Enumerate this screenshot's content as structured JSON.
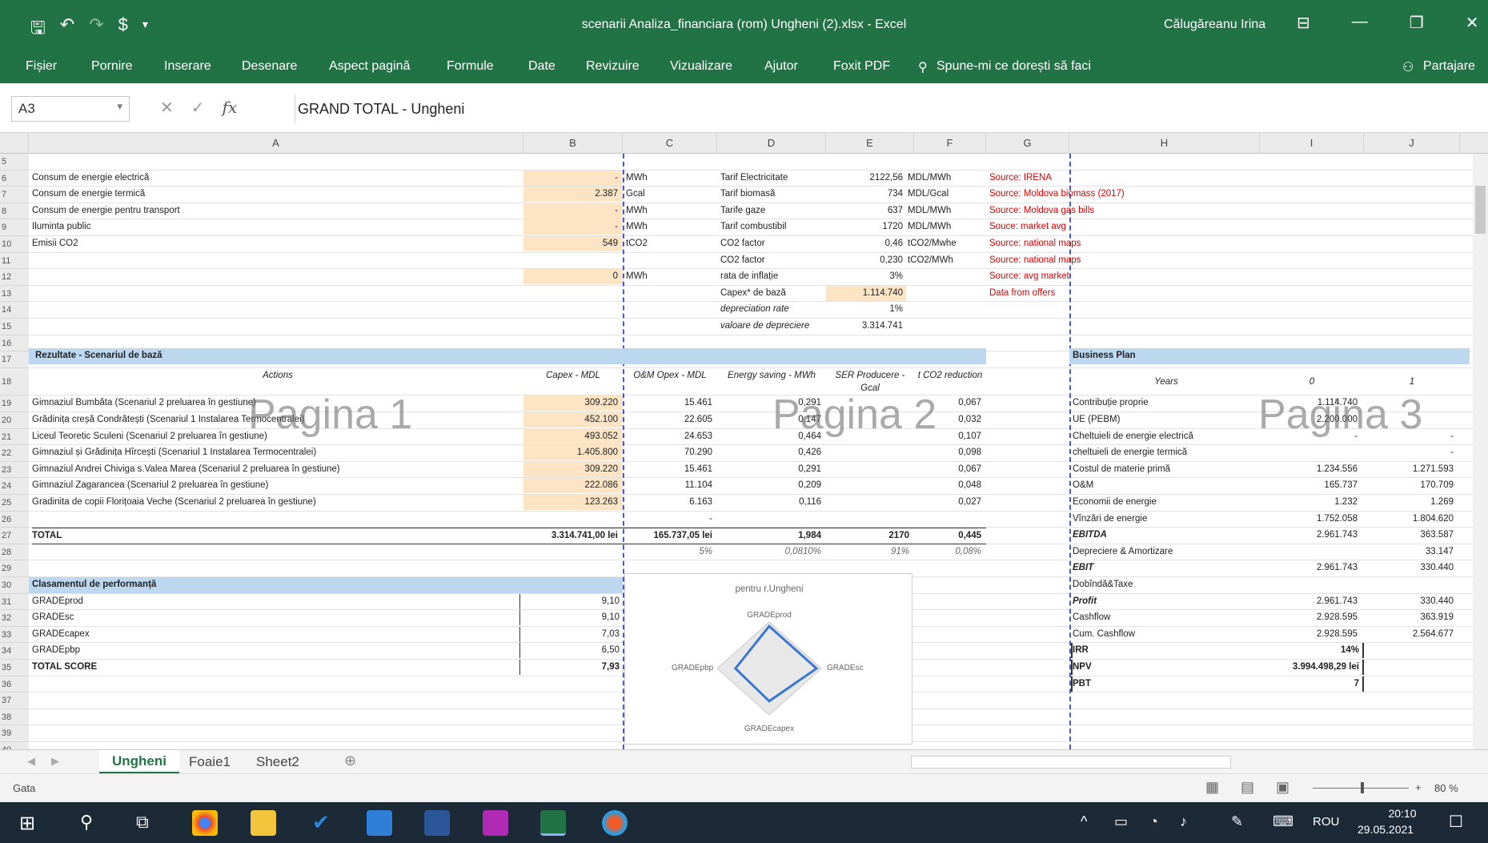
{
  "window": {
    "title": "scenarii Analiza_financiara (rom) Ungheni (2).xlsx  -  Excel",
    "user": "Călugăreanu Irina"
  },
  "ribbon": {
    "tabs": [
      "Fișier",
      "Pornire",
      "Inserare",
      "Desenare",
      "Aspect pagină",
      "Formule",
      "Date",
      "Revizuire",
      "Vizualizare",
      "Ajutor",
      "Foxit PDF"
    ],
    "tell_me": "Spune-mi ce dorești să faci",
    "share": "Partajare"
  },
  "formula_bar": {
    "name_box": "A3",
    "content": "GRAND TOTAL - Ungheni"
  },
  "columns": [
    "A",
    "B",
    "C",
    "D",
    "E",
    "F",
    "G",
    "H",
    "I",
    "J"
  ],
  "rows": [
    "5",
    "6",
    "7",
    "8",
    "9",
    "10",
    "11",
    "12",
    "13",
    "14",
    "15",
    "16",
    "17",
    "18",
    "19",
    "20",
    "21",
    "22",
    "23",
    "24",
    "25",
    "26",
    "27",
    "28",
    "29",
    "30",
    "31",
    "32",
    "33",
    "34",
    "35",
    "36",
    "37",
    "38",
    "39",
    "40"
  ],
  "inputs": [
    {
      "label": "Consum de energie electrică",
      "value": "-",
      "unit": "MWh"
    },
    {
      "label": "Consum de energie termică",
      "value": "2.387",
      "unit": "Gcal"
    },
    {
      "label": "Consum de energie pentru transport",
      "value": "-",
      "unit": "MWh"
    },
    {
      "label": "Iluminta public",
      "value": "-",
      "unit": "MWh"
    },
    {
      "label": "Emisii CO2",
      "value": "549",
      "unit": "tCO2"
    },
    {
      "label": "",
      "value": "",
      "unit": ""
    },
    {
      "label": "",
      "value": "0",
      "unit": "MWh"
    }
  ],
  "tariffs": [
    {
      "name": "Tarif Electricitate",
      "value": "2122,56",
      "unit": "MDL/MWh",
      "source": "Source: IRENA"
    },
    {
      "name": "Tarif biomasă",
      "value": "734",
      "unit": "MDL/Gcal",
      "source": "Source: Moldova biomass (2017)"
    },
    {
      "name": "Tarife gaze",
      "value": "637",
      "unit": "MDL/MWh",
      "source": "Source: Moldova gas bills"
    },
    {
      "name": "Tarif combustibil",
      "value": "1720",
      "unit": "MDL/MWh",
      "source": "Souce: market avg"
    },
    {
      "name": "CO2 factor",
      "value": "0,46",
      "unit": "tCO2/Mwhe",
      "source": "Source: national maps"
    },
    {
      "name": "CO2 factor",
      "value": "0,230",
      "unit": "tCO2/MWh",
      "source": "Source: national maps"
    },
    {
      "name": "rata de inflație",
      "value": "3%",
      "unit": "",
      "source": "Source: avg market"
    },
    {
      "name": "Capex* de bază",
      "value": "1.114.740",
      "unit": "",
      "source": "Data from offers"
    },
    {
      "name": "depreciation rate",
      "value": "1%",
      "unit": "",
      "source": ""
    },
    {
      "name": "valoare de depreciere",
      "value": "3.314.741",
      "unit": "",
      "source": ""
    }
  ],
  "results": {
    "title": "Rezultate - Scenariul de bază",
    "headers": [
      "Actions",
      "Capex - MDL",
      "O&M Opex - MDL",
      "Energy saving - MWh",
      "SER Producere - Gcal",
      "t CO2 reduction"
    ],
    "rows": [
      [
        "Gimnaziul Bumbăta (Scenariul 2 preluarea în gestiune)",
        "309.220",
        "15.461",
        "0,291",
        "",
        "0,067"
      ],
      [
        "Grădinița creșă Condrătești (Scenariul 1 Instalarea Termocentralei)",
        "452.100",
        "22.605",
        "0,147",
        "",
        "0,032"
      ],
      [
        "Liceul Teoretic Sculeni (Scenariul 2 preluarea în gestiune)",
        "493.052",
        "24.653",
        "0,464",
        "",
        "0,107"
      ],
      [
        "Gimnaziul și Grădinița Hîrcești (Scenariul 1 Instalarea Termocentralei)",
        "1.405.800",
        "70.290",
        "0,426",
        "",
        "0,098"
      ],
      [
        "Gimnaziul Andrei Chiviga s.Valea Marea (Scenariul 2 preluarea în gestiune)",
        "309.220",
        "15.461",
        "0,291",
        "",
        "0,067"
      ],
      [
        "Gimnaziul Zagarancea (Scenariul 2 preluarea în gestiune)",
        "222.086",
        "11.104",
        "0,209",
        "",
        "0,048"
      ],
      [
        "Gradinita de copii Florițoaia Veche (Scenariul 2 preluarea în gestiune)",
        "123.263",
        "6.163",
        "0,116",
        "",
        "0,027"
      ],
      [
        "",
        "",
        "-",
        "",
        "",
        ""
      ]
    ],
    "total": [
      "TOTAL",
      "3.314.741,00 lei",
      "165.737,05 lei",
      "1,984",
      "2170",
      "0,445"
    ],
    "pct": [
      "",
      "",
      "5%",
      "0,0810%",
      "91%",
      "0,08%"
    ]
  },
  "performance": {
    "title": "Clasamentul de performanță",
    "rows": [
      [
        "GRADEprod",
        "9,10"
      ],
      [
        "GRADEsc",
        "9,10"
      ],
      [
        "GRADEcapex",
        "7,03"
      ],
      [
        "GRADEpbp",
        "6,50"
      ],
      [
        "TOTAL SCORE",
        "7,93"
      ]
    ],
    "radar_title": "pentru r.Ungheni",
    "radar_labels": [
      "GRADEprod",
      "GRADEsc",
      "GRADEcapex",
      "GRADEpbp"
    ]
  },
  "business_plan": {
    "title": "Business Plan",
    "header": [
      "Years",
      "0",
      "1"
    ],
    "rows": [
      [
        "Contribuție proprie",
        "1.114.740",
        ""
      ],
      [
        "UE (PEBM)",
        "2.200.000",
        ""
      ],
      [
        "Cheltuieli de energie electrică",
        "-",
        "-"
      ],
      [
        "cheltuieli de energie termică",
        "",
        "-"
      ],
      [
        "Costul de materie primă",
        "1.234.556",
        "1.271.593"
      ],
      [
        "O&M",
        "165.737",
        "170.709"
      ],
      [
        "Economii de energie",
        "1.232",
        "1.269"
      ],
      [
        "Vînzări de energie",
        "1.752.058",
        "1.804.620"
      ],
      [
        "EBITDA",
        "2.961.743",
        "363.587"
      ],
      [
        "Depreciere & Amortizare",
        "",
        "33.147"
      ],
      [
        "EBIT",
        "2.961.743",
        "330.440"
      ],
      [
        "Dobîndă&Taxe",
        "",
        ""
      ],
      [
        "Profit",
        "2.961.743",
        "330.440"
      ],
      [
        "Cashflow",
        "2.928.595",
        "363.919"
      ],
      [
        "Cum. Cashflow",
        "2.928.595",
        "2.564.677"
      ]
    ],
    "irr": [
      "IRR",
      "14%"
    ],
    "npv": [
      "NPV",
      "3.994.498,29 lei"
    ],
    "pbt": [
      "PBT",
      "7"
    ]
  },
  "watermarks": [
    "Pagina 1",
    "Pagina 2",
    "Pagina 3"
  ],
  "sheets": [
    "Ungheni",
    "Foaie1",
    "Sheet2"
  ],
  "status": {
    "ready": "Gata",
    "zoom": "80 %"
  },
  "taskbar": {
    "lang": "ROU",
    "time": "20:10",
    "date": "29.05.2021"
  }
}
